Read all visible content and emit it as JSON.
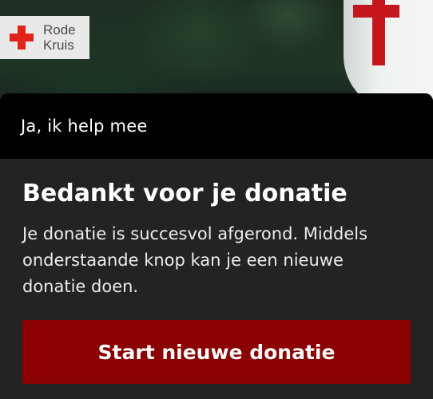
{
  "brand": {
    "logo_line1": "Rode",
    "logo_line2": "Kruis",
    "logo_icon": "red-cross-icon",
    "accent_color": "#e2231a"
  },
  "card": {
    "header_title": "Ja, ik help mee",
    "title": "Bedankt voor je donatie",
    "message": "Je donatie is succesvol afgerond. Middels onderstaande knop kan je een nieuwe donatie doen.",
    "button_label": "Start nieuwe donatie",
    "button_color": "#8b0000"
  }
}
